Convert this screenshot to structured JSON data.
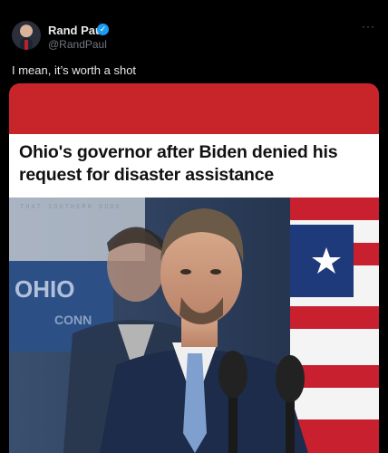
{
  "post": {
    "author_name": "Rand Paul",
    "author_handle": "@RandPaul",
    "verified_icon": "verified-badge-icon",
    "more_label": "···",
    "text": "I mean, it’s worth a shot"
  },
  "media": {
    "headline": "Ohio's governor after Biden denied his request for disaster assistance",
    "credit": "THAT SOUTHERN DUDE",
    "podium_sign": "OHIO",
    "podium_sign_sub": "CONN"
  },
  "colors": {
    "accent_blue": "#1d9bf0",
    "banner_red": "#c8252b"
  }
}
